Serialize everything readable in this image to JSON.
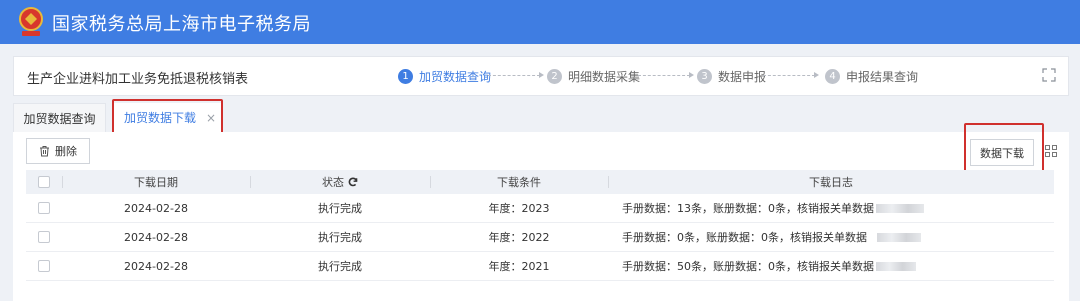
{
  "header": {
    "title": "国家税务总局上海市电子税务局"
  },
  "steps_card": {
    "form_title": "生产企业进料加工业务免抵退税核销表",
    "steps": [
      {
        "num": "1",
        "label": "加贸数据查询",
        "active": true
      },
      {
        "num": "2",
        "label": "明细数据采集",
        "active": false
      },
      {
        "num": "3",
        "label": "数据申报",
        "active": false
      },
      {
        "num": "4",
        "label": "申报结果查询",
        "active": false
      }
    ]
  },
  "tabs": [
    {
      "label": "加贸数据查询"
    },
    {
      "label": "加贸数据下载",
      "close": "×"
    }
  ],
  "toolbar": {
    "delete_label": "删除",
    "download_label": "数据下载"
  },
  "table": {
    "columns": {
      "date": "下载日期",
      "status": "状态",
      "condition": "下载条件",
      "log": "下载日志"
    },
    "rows": [
      {
        "date": "2024-02-28",
        "status": "执行完成",
        "condition": "年度：2023",
        "log": "手册数据：13条，账册数据：0条，核销报关单数据"
      },
      {
        "date": "2024-02-28",
        "status": "执行完成",
        "condition": "年度：2022",
        "log": "手册数据：0条，账册数据：0条，核销报关单数据"
      },
      {
        "date": "2024-02-28",
        "status": "执行完成",
        "condition": "年度：2021",
        "log": "手册数据：50条，账册数据：0条，核销报关单数据"
      }
    ]
  },
  "colors": {
    "brand": "#3f7de2",
    "highlight": "#d0302d"
  }
}
